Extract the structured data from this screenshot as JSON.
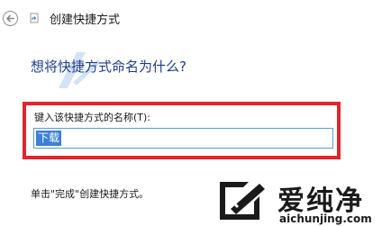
{
  "window": {
    "title": "创建快捷方式"
  },
  "main": {
    "question": "想将快捷方式命名为什么?",
    "name_label": "键入该快捷方式的名称(T):",
    "name_value": "下载",
    "hint": "单击\"完成\"创建快捷方式。"
  },
  "watermark": {
    "brand_name": "爱纯净",
    "url": "aichunjing.com"
  },
  "colors": {
    "heading": "#1c3c8c",
    "highlight_border": "#e0262c",
    "selection": "#3b80d6",
    "input_border": "#5a9ad5"
  },
  "icons": {
    "back": "back-arrow-icon",
    "wizard": "shortcut-wizard-icon",
    "brand": "aichunjing-logo-icon"
  }
}
